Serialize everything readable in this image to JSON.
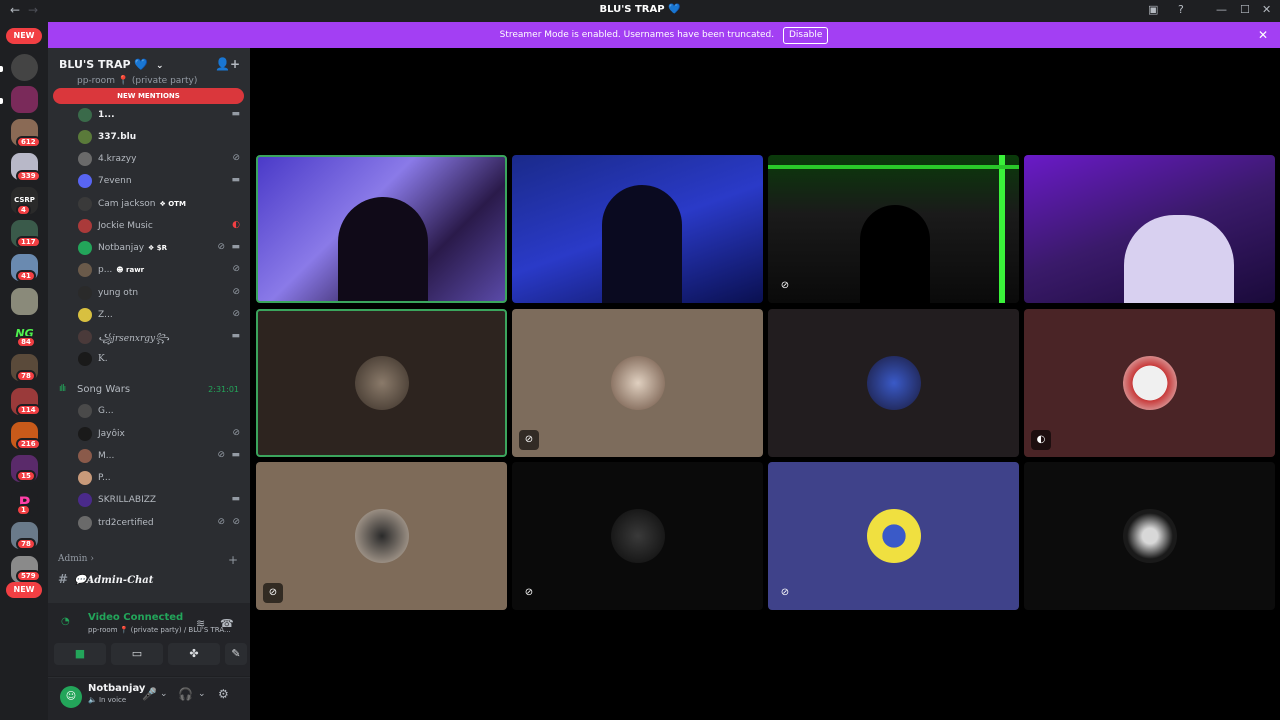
{
  "window": {
    "title": "BLU'S TRAP 💙",
    "back": "←",
    "forward": "→",
    "controls": {
      "inbox": "▣",
      "help": "?",
      "minimize": "—",
      "maximize": "☐",
      "close": "✕"
    }
  },
  "banner": {
    "text": "Streamer Mode is enabled. Usernames have been truncated.",
    "button": "Disable",
    "close": "✕"
  },
  "guild_bar": {
    "new_top": "NEW",
    "new_bottom": "NEW",
    "badges": [
      "612",
      "339",
      "4",
      "117",
      "41",
      "84",
      "78",
      "114",
      "216",
      "15",
      "1",
      "78",
      "579"
    ],
    "labels": {
      "csrp": "CSRP",
      "ng": "NG",
      "p": "P"
    }
  },
  "sidebar": {
    "server_name": "BLU'S TRAP 💙",
    "server_chevron": "⌄",
    "add_member_icon": "👤+",
    "partial_channel": "pp-room 📍 (private party)",
    "new_mentions": "NEW MENTIONS",
    "pp_room_users": [
      {
        "name": "1...",
        "icon": "▬",
        "tag": "",
        "icon2": ""
      },
      {
        "name": "337.blu",
        "icon": "",
        "tag": "",
        "icon2": ""
      },
      {
        "name": "4.krazyy",
        "icon": "⊘",
        "tag": "",
        "icon2": ""
      },
      {
        "name": "7evenn",
        "icon": "▬",
        "tag": "",
        "icon2": ""
      },
      {
        "name": "Cam jackson",
        "icon": "",
        "tag": "❖ OTM",
        "icon2": ""
      },
      {
        "name": "Jockie Music",
        "icon": "◐",
        "tag": "",
        "icon2": ""
      },
      {
        "name": "Notbanjay",
        "icon": "▬",
        "tag": "❖ $R",
        "icon2": "⊘"
      },
      {
        "name": "p...",
        "icon": "⊘",
        "tag": "☻ rawr",
        "icon2": ""
      },
      {
        "name": "yung otn",
        "icon": "⊘",
        "tag": "",
        "icon2": ""
      },
      {
        "name": "Z...",
        "icon": "⊘",
        "tag": "",
        "icon2": ""
      },
      {
        "name": "꧁jrsenxrgy꧂",
        "icon": "▬",
        "tag": "",
        "icon2": ""
      },
      {
        "name": "K.",
        "icon": "",
        "tag": "",
        "icon2": ""
      }
    ],
    "song_wars": {
      "wave": "ıIlı",
      "label": "Song Wars",
      "time": "2:31:01",
      "users": [
        {
          "name": "G...",
          "icon": "",
          "icon2": ""
        },
        {
          "name": "Jayôix",
          "icon": "⊘",
          "icon2": ""
        },
        {
          "name": "M...",
          "icon": "▬",
          "icon2": "⊘"
        },
        {
          "name": "P...",
          "icon": "",
          "icon2": ""
        },
        {
          "name": "SKRILLABIZZ",
          "icon": "▬",
          "icon2": ""
        },
        {
          "name": "trd2certified",
          "icon": "⊘",
          "icon2": "⊘"
        }
      ]
    },
    "admin_category": "Admin ›",
    "admin_plus": "+",
    "admin_channel": "💬Admin-Chat",
    "admin_hash": "#"
  },
  "voice_panel": {
    "signal_icon": "◔",
    "status": "Video Connected",
    "location": "pp-room 📍 (private party) / BLU'S TRA...",
    "noise_icon": "≋",
    "disconnect_icon": "☎",
    "buttons": {
      "camera": "■",
      "screen": "▭",
      "activities": "✤",
      "soundboard": "✎"
    }
  },
  "user_panel": {
    "avatar_glyph": "☺",
    "username": "Notbanjay",
    "status": "🔈 In voice",
    "mic_icon": "🎤",
    "chevron1": "⌄",
    "headphones_icon": "🎧",
    "chevron2": "⌄",
    "settings_icon": "⚙"
  },
  "video_tiles": [
    {
      "kind": "video",
      "mic": "",
      "speaking": true
    },
    {
      "kind": "video",
      "mic": "",
      "speaking": false
    },
    {
      "kind": "video",
      "mic": "⊘",
      "speaking": false
    },
    {
      "kind": "video",
      "mic": "",
      "speaking": false
    },
    {
      "kind": "avatar",
      "mic": "",
      "speaking": true
    },
    {
      "kind": "avatar",
      "mic": "⊘",
      "speaking": false
    },
    {
      "kind": "avatar",
      "mic": "",
      "speaking": false
    },
    {
      "kind": "avatar",
      "mic": "◐",
      "speaking": false
    },
    {
      "kind": "avatar",
      "mic": "⊘",
      "speaking": false
    },
    {
      "kind": "avatar",
      "mic": "⊘",
      "speaking": false
    },
    {
      "kind": "avatar",
      "mic": "⊘",
      "speaking": false
    },
    {
      "kind": "avatar",
      "mic": "",
      "speaking": false
    }
  ],
  "colors": {
    "banner": "#a33ff3",
    "speaking": "#3ba55d",
    "mention_red": "#f23f43",
    "online_green": "#23a55a"
  }
}
